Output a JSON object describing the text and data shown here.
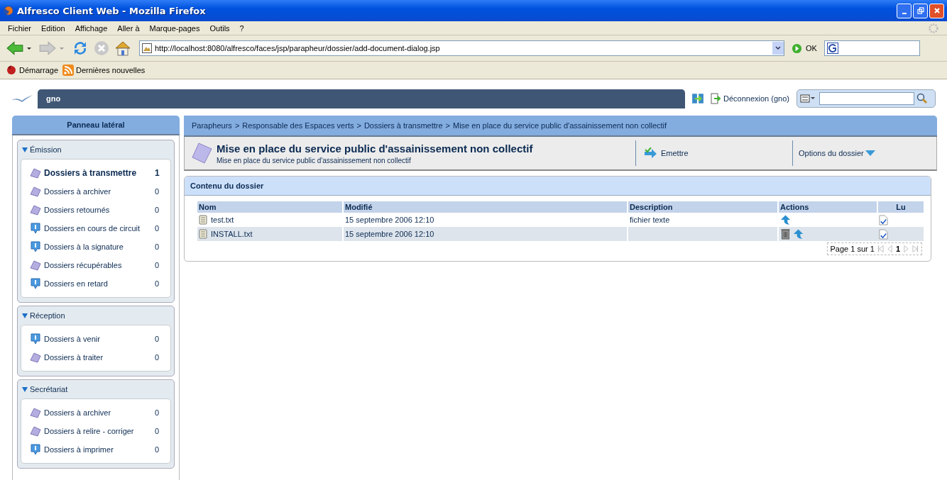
{
  "window": {
    "title": "Alfresco Client Web - Mozilla Firefox"
  },
  "menu": [
    "Fichier",
    "Edition",
    "Affichage",
    "Aller à",
    "Marque-pages",
    "Outils",
    "?"
  ],
  "address": {
    "value": "http://localhost:8080/alfresco/faces/jsp/parapheur/dossier/add-document-dialog.jsp",
    "go": "OK"
  },
  "bookmarks": [
    {
      "label": "Démarrage",
      "kind": "home"
    },
    {
      "label": "Dernières nouvelles",
      "kind": "rss"
    }
  ],
  "header": {
    "user": "gno",
    "logout": "Déconnexion (gno)"
  },
  "sidebar": {
    "title": "Panneau latéral",
    "groups": [
      {
        "title": "Émission",
        "expanded": true,
        "items": [
          {
            "label": "Dossiers à transmettre",
            "count": "1",
            "kind": "folder",
            "selected": true
          },
          {
            "label": "Dossiers à archiver",
            "count": "0",
            "kind": "folder",
            "selected": false
          },
          {
            "label": "Dossiers retournés",
            "count": "0",
            "kind": "folder",
            "selected": false
          },
          {
            "label": "Dossiers en cours de circuit",
            "count": "0",
            "kind": "info",
            "selected": false
          },
          {
            "label": "Dossiers à la signature",
            "count": "0",
            "kind": "info",
            "selected": false
          },
          {
            "label": "Dossiers récupérables",
            "count": "0",
            "kind": "folder",
            "selected": false
          },
          {
            "label": "Dossiers en retard",
            "count": "0",
            "kind": "info",
            "selected": false
          }
        ]
      },
      {
        "title": "Réception",
        "expanded": true,
        "items": [
          {
            "label": "Dossiers à venir",
            "count": "0",
            "kind": "info",
            "selected": false
          },
          {
            "label": "Dossiers à traiter",
            "count": "0",
            "kind": "folder",
            "selected": false
          }
        ]
      },
      {
        "title": "Secrétariat",
        "expanded": true,
        "items": [
          {
            "label": "Dossiers à archiver",
            "count": "0",
            "kind": "folder",
            "selected": false
          },
          {
            "label": "Dossiers à relire - corriger",
            "count": "0",
            "kind": "folder",
            "selected": false
          },
          {
            "label": "Dossiers à imprimer",
            "count": "0",
            "kind": "info",
            "selected": false
          }
        ]
      }
    ]
  },
  "breadcrumb": [
    "Parapheurs",
    "Responsable des Espaces verts",
    "Dossiers à transmettre",
    "Mise en place du service public d'assainissement non collectif"
  ],
  "breadcrumb_separator": ">",
  "dossier": {
    "title": "Mise en place du service public d'assainissement non collectif",
    "subtitle": "Mise en place du service public d'assainissement non collectif",
    "action": "Emettre",
    "options": "Options du dossier"
  },
  "contents": {
    "title": "Contenu du dossier",
    "columns": [
      "Nom",
      "Modifié",
      "Description",
      "Actions",
      "Lu"
    ],
    "rows": [
      {
        "name": "test.txt",
        "modified": "15 septembre 2006 12:10",
        "description": "fichier texte",
        "actions": [
          {
            "kind": "up"
          }
        ],
        "read": true
      },
      {
        "name": "INSTALL.txt",
        "modified": "15 septembre 2006 12:10",
        "actions": [
          {
            "kind": "delete"
          },
          {
            "kind": "up"
          }
        ],
        "read": true
      }
    ],
    "pager": {
      "label": "Page 1 sur 1",
      "page": "1"
    }
  }
}
